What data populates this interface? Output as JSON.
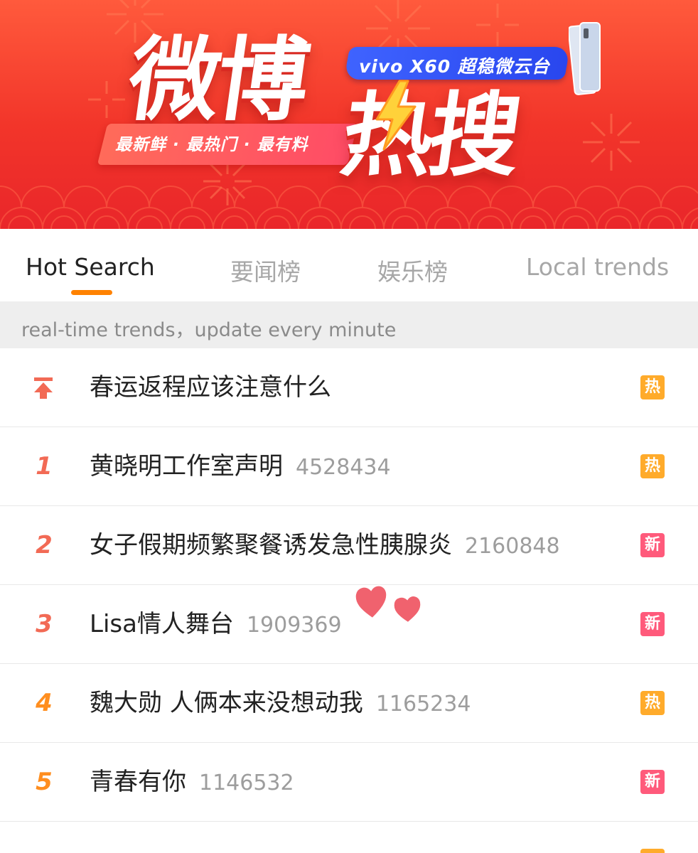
{
  "banner": {
    "title_part1": "微博",
    "title_part2": "热搜",
    "slogan": "最新鲜 · 最热门 · 最有料",
    "ad": "vivo X60 超稳微云台"
  },
  "tabs": [
    {
      "label": "Hot Search",
      "active": true
    },
    {
      "label": "要闻榜",
      "active": false
    },
    {
      "label": "娱乐榜",
      "active": false
    },
    {
      "label": "Local trends",
      "active": false
    }
  ],
  "notice": "real-time trends，update every minute",
  "colors": {
    "banner_red": "#f2352a",
    "tab_indicator": "#ff8200",
    "rank_top3": "#f26a55",
    "rank_other": "#ff8e1f",
    "badge_hot": "#ffab2b",
    "badge_new": "#ff5a7b"
  },
  "list": {
    "items": [
      {
        "rank": "",
        "rank_icon": "pin-to-top-icon",
        "topic": "春运返程应该注意什么",
        "count": "",
        "badge": "热",
        "badge_type": "hot"
      },
      {
        "rank": "1",
        "topic": "黄晓明工作室声明",
        "count": "4528434",
        "badge": "热",
        "badge_type": "hot"
      },
      {
        "rank": "2",
        "topic": "女子假期频繁聚餐诱发急性胰腺炎",
        "count": "2160848",
        "badge": "新",
        "badge_type": "new"
      },
      {
        "rank": "3",
        "topic": "Lisa情人舞台",
        "count": "1909369",
        "badge": "新",
        "badge_type": "new"
      },
      {
        "rank": "4",
        "topic": "魏大勋 人俩本来没想动我",
        "count": "1165234",
        "badge": "热",
        "badge_type": "hot"
      },
      {
        "rank": "5",
        "topic": "青春有你",
        "count": "1146532",
        "badge": "新",
        "badge_type": "new"
      }
    ]
  },
  "sticker": "hearts-icon"
}
